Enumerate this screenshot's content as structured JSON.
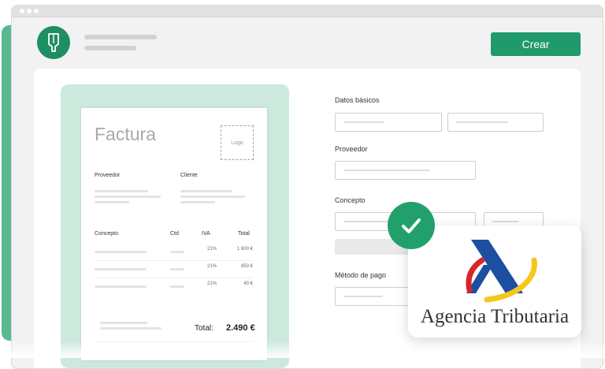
{
  "header": {
    "create_button_label": "Crear"
  },
  "invoice": {
    "title": "Factura",
    "logo_placeholder": "Logo",
    "supplier_label": "Proveedor",
    "client_label": "Cliente",
    "columns": [
      "Concepto",
      "Ctd",
      "IVA",
      "Total"
    ],
    "rows": [
      {
        "iva": "21%",
        "total": "1 600 €"
      },
      {
        "iva": "21%",
        "total": "850 €"
      },
      {
        "iva": "21%",
        "total": "40 €"
      }
    ],
    "total_label": "Total:",
    "total_value": "2.490 €"
  },
  "form": {
    "basic_data_label": "Datos básicos",
    "supplier_label": "Proveedor",
    "concept_label": "Concepto",
    "payment_method_label": "Método de pago"
  },
  "badge": {
    "agency_name": "Agencia Tributaria",
    "check_icon": "checkmark-icon"
  },
  "colors": {
    "brand_green": "#1f9a6a",
    "light_green": "#cde9dd",
    "agency_blue": "#1c4fa0",
    "agency_yellow": "#f4c81a",
    "agency_red": "#d6262a"
  }
}
